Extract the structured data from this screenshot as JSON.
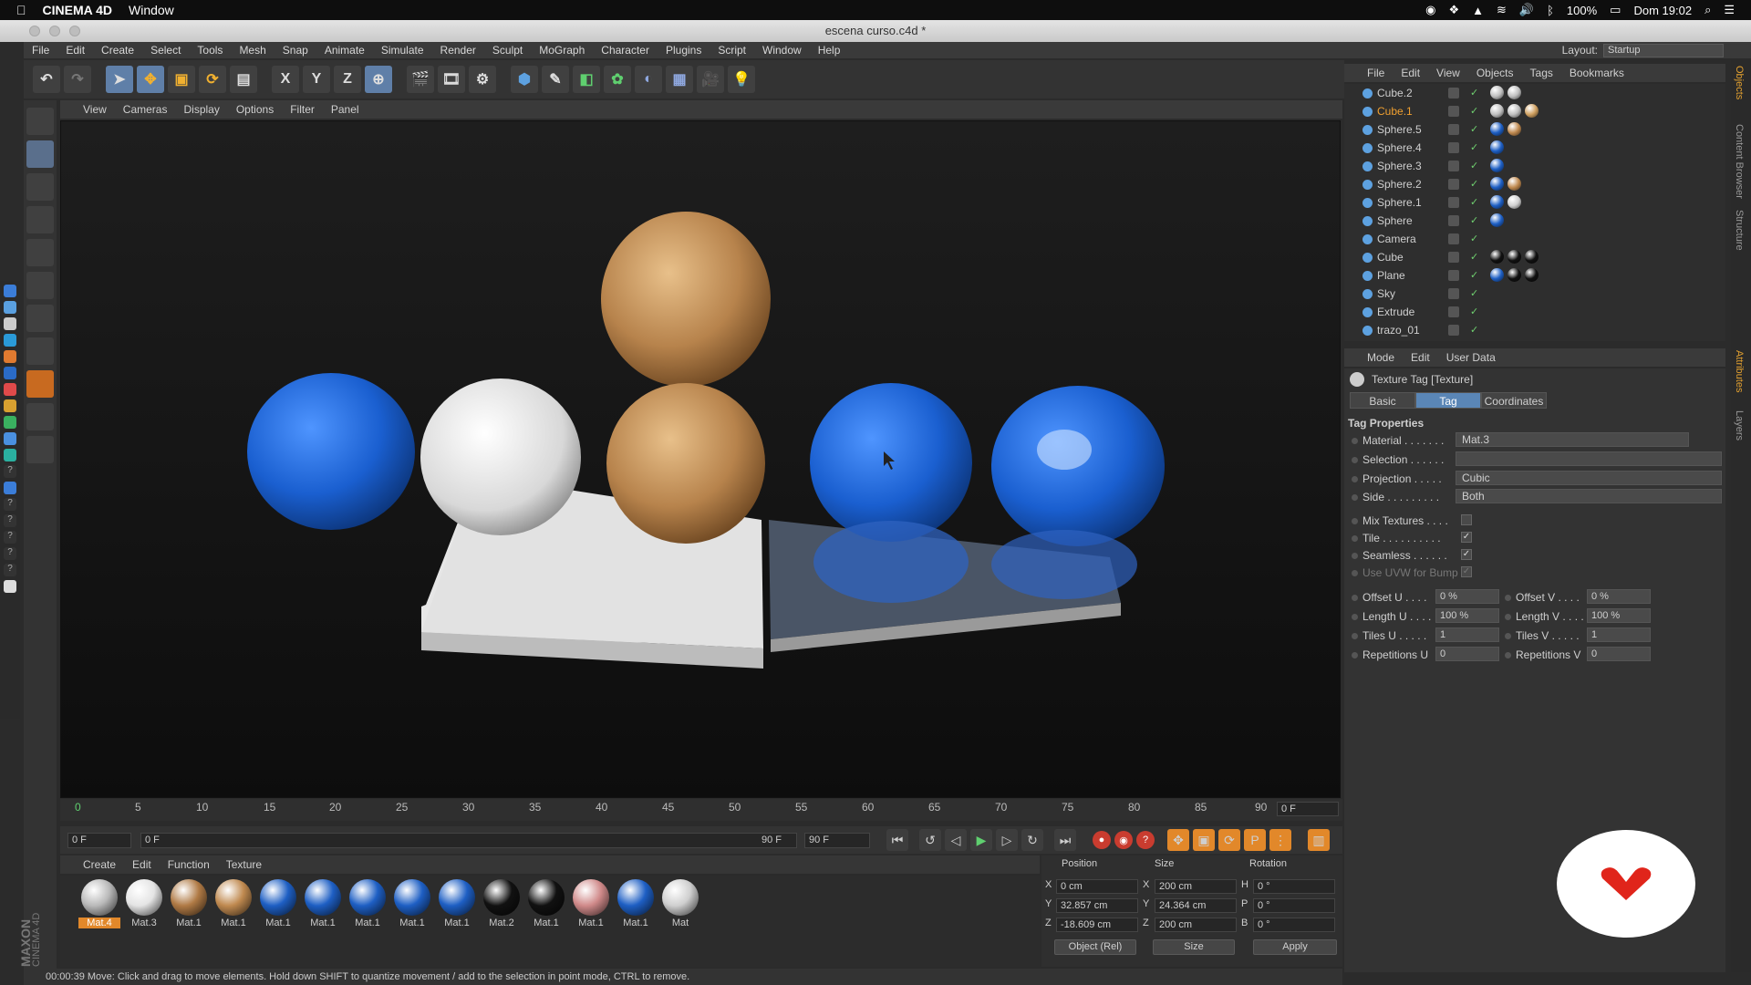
{
  "mac": {
    "app": "CINEMA 4D",
    "menu": "Window",
    "battery": "100%",
    "clock": "Dom 19:02"
  },
  "window": {
    "title": "escena curso.c4d *"
  },
  "menubar": [
    "File",
    "Edit",
    "Create",
    "Select",
    "Tools",
    "Mesh",
    "Snap",
    "Animate",
    "Simulate",
    "Render",
    "Sculpt",
    "MoGraph",
    "Character",
    "Plugins",
    "Script",
    "Window",
    "Help"
  ],
  "layout": {
    "label": "Layout:",
    "value": "Startup"
  },
  "toolbar": {
    "x_label": "X",
    "y_label": "Y",
    "z_label": "Z"
  },
  "viewport": {
    "menu": [
      "View",
      "Cameras",
      "Display",
      "Options",
      "Filter",
      "Panel"
    ]
  },
  "timeline": {
    "ticks": [
      "0",
      "5",
      "10",
      "15",
      "20",
      "25",
      "30",
      "35",
      "40",
      "45",
      "50",
      "55",
      "60",
      "65",
      "70",
      "75",
      "80",
      "85",
      "90"
    ],
    "current_frame": "0 F",
    "start": "0 F",
    "range_start": "0 F",
    "range_end": "90 F",
    "end": "90 F"
  },
  "materials": {
    "menu": [
      "Create",
      "Edit",
      "Function",
      "Texture"
    ],
    "items": [
      {
        "label": "Mat.4",
        "color": "#b9b9b9",
        "selected": true
      },
      {
        "label": "Mat.3",
        "color": "#e4e4e4"
      },
      {
        "label": "Mat.1",
        "color": "#b07a45"
      },
      {
        "label": "Mat.1",
        "color": "#c08a50"
      },
      {
        "label": "Mat.1",
        "color": "#1e5fc4"
      },
      {
        "label": "Mat.1",
        "color": "#1e5fc4"
      },
      {
        "label": "Mat.1",
        "color": "#1e5fc4"
      },
      {
        "label": "Mat.1",
        "color": "#1e5fc4"
      },
      {
        "label": "Mat.1",
        "color": "#1e5fc4"
      },
      {
        "label": "Mat.2",
        "color": "#111111"
      },
      {
        "label": "Mat.1",
        "color": "#111111"
      },
      {
        "label": "Mat.1",
        "color": "#d08a8a"
      },
      {
        "label": "Mat.1",
        "color": "#1e5fc4"
      },
      {
        "label": "Mat",
        "color": "#cfcfcf"
      }
    ]
  },
  "coordinates": {
    "headers": [
      "Position",
      "Size",
      "Rotation"
    ],
    "rows": [
      {
        "a": "X",
        "pos": "0 cm",
        "b": "X",
        "size": "200 cm",
        "c": "H",
        "rot": "0 °"
      },
      {
        "a": "Y",
        "pos": "32.857 cm",
        "b": "Y",
        "size": "24.364 cm",
        "c": "P",
        "rot": "0 °"
      },
      {
        "a": "Z",
        "pos": "-18.609 cm",
        "b": "Z",
        "size": "200 cm",
        "c": "B",
        "rot": "0 °"
      }
    ],
    "mode": "Object (Rel)",
    "size_mode": "Size",
    "apply": "Apply"
  },
  "status": "00:00:39    Move: Click and drag to move elements. Hold down SHIFT to quantize movement / add to the selection in point mode, CTRL to remove.",
  "objects": {
    "menu": [
      "File",
      "Edit",
      "View",
      "Objects",
      "Tags",
      "Bookmarks"
    ],
    "rows": [
      {
        "name": "Cube.2",
        "tags": [
          "#c0c0c0",
          "#c0c0c0"
        ]
      },
      {
        "name": "Cube.1",
        "tags": [
          "#c0c0c0",
          "#c0c0c0",
          "#d0a060"
        ],
        "highlight": true
      },
      {
        "name": "Sphere.5",
        "tags": [
          "#1e5fc4",
          "#c08a50"
        ]
      },
      {
        "name": "Sphere.4",
        "tags": [
          "#1e5fc4"
        ]
      },
      {
        "name": "Sphere.3",
        "tags": [
          "#1e5fc4"
        ]
      },
      {
        "name": "Sphere.2",
        "tags": [
          "#1e5fc4",
          "#c08a50"
        ]
      },
      {
        "name": "Sphere.1",
        "tags": [
          "#1e5fc4",
          "#d0d0d0"
        ]
      },
      {
        "name": "Sphere",
        "tags": [
          "#1e5fc4"
        ]
      },
      {
        "name": "Camera",
        "tags": []
      },
      {
        "name": "Cube",
        "tags": [
          "#111111",
          "#111111",
          "#111111"
        ]
      },
      {
        "name": "Plane",
        "tags": [
          "#1e5fc4",
          "#111111",
          "#111111"
        ]
      },
      {
        "name": "Sky",
        "tags": []
      },
      {
        "name": "Extrude",
        "tags": []
      },
      {
        "name": "trazo_01",
        "tags": []
      }
    ]
  },
  "side_tabs": [
    "Objects",
    "Content Browser",
    "Structure",
    "Attributes",
    "Layers"
  ],
  "attributes": {
    "menu": [
      "Mode",
      "Edit",
      "User Data"
    ],
    "title": "Texture Tag [Texture]",
    "tabs": [
      "Basic",
      "Tag",
      "Coordinates"
    ],
    "section": "Tag Properties",
    "material_label": "Material . . . . . . .",
    "material": "Mat.3",
    "selection_label": "Selection . . . . . .",
    "projection_label": "Projection . . . . .",
    "projection": "Cubic",
    "side_label": "Side . . . . . . . . .",
    "side": "Both",
    "mix_label": "Mix Textures . . . .",
    "tile_label": "Tile . . . . . . . . . .",
    "seamless_label": "Seamless . . . . . .",
    "uvw_label": "Use UVW for Bump",
    "offset_u_label": "Offset U . . . .",
    "offset_u": "0 %",
    "offset_v_label": "Offset V . . . .",
    "offset_v": "0 %",
    "length_u_label": "Length U . . . .",
    "length_u": "100 %",
    "length_v_label": "Length V . . . .",
    "length_v": "100 %",
    "tiles_u_label": "Tiles U . . . . .",
    "tiles_u": "1",
    "tiles_v_label": "Tiles V . . . . .",
    "tiles_v": "1",
    "reps_u_label": "Repetitions U",
    "reps_u": "0",
    "reps_v_label": "Repetitions V",
    "reps_v": "0"
  },
  "brand": {
    "maxon": "MAXON",
    "c4d": "CINEMA 4D"
  }
}
